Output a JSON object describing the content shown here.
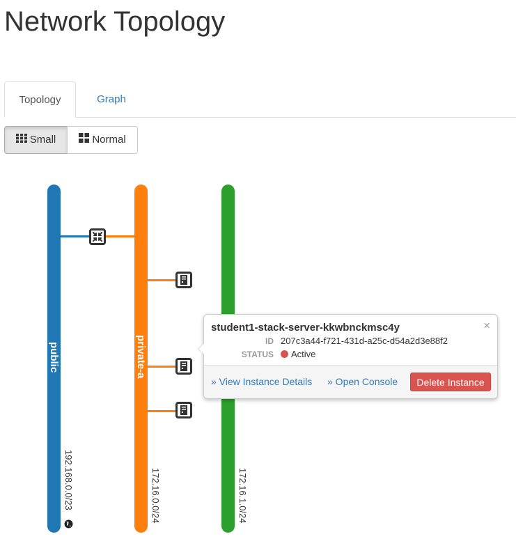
{
  "page": {
    "title": "Network Topology"
  },
  "tabs": [
    {
      "label": "Topology",
      "active": true
    },
    {
      "label": "Graph",
      "active": false
    }
  ],
  "size_toggle": {
    "small_label": "Small",
    "normal_label": "Normal",
    "selected": "Small"
  },
  "networks": [
    {
      "name": "public",
      "cidr": "192.168.0.0/23",
      "color": "#1f77b4",
      "external": true
    },
    {
      "name": "private-a",
      "cidr": "172.16.0.0/24",
      "color": "#ff7f0e"
    },
    {
      "name": "",
      "cidr": "172.16.1.0/24",
      "color": "#2ca02c"
    }
  ],
  "devices": [
    {
      "type": "router-icon"
    },
    {
      "type": "instance-icon"
    },
    {
      "type": "instance-icon"
    },
    {
      "type": "instance-icon"
    }
  ],
  "popup": {
    "name": "student1-stack-server-kkwbnckmsc4y",
    "close": "×",
    "id_label": "ID",
    "id_value": "207c3a44-f721-431d-a25c-d54a2d3e88f2",
    "status_label": "STATUS",
    "status_value": "Active",
    "status_color": "#d9534f",
    "view_details": "» View Instance Details",
    "open_console": "» Open Console",
    "delete": "Delete Instance"
  }
}
